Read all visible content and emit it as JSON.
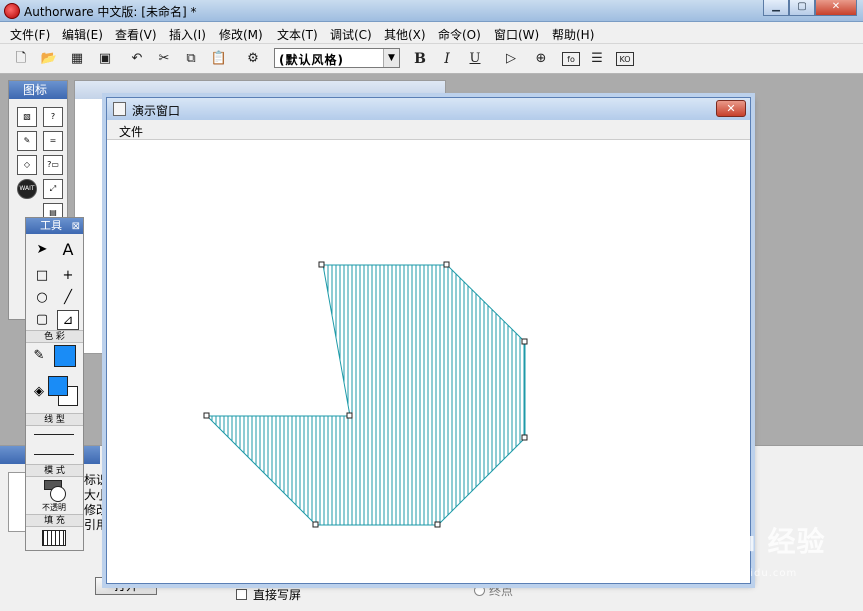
{
  "app": {
    "title": "Authorware 中文版: [未命名] *"
  },
  "menubar": {
    "items": [
      "文件(F)",
      "编辑(E)",
      "查看(V)",
      "插入(I)",
      "修改(M)",
      "文本(T)",
      "调试(C)",
      "其他(X)",
      "命令(O)",
      "窗口(W)",
      "帮助(H)"
    ]
  },
  "toolbar": {
    "style_select_value": "(默认风格)",
    "bold_label": "B",
    "italic_label": "I",
    "underline_label": "U"
  },
  "icons_panel": {
    "title": "图标",
    "wait_icon_label": "WAIT"
  },
  "tools_panel": {
    "title": "工具",
    "color_section": "色 彩",
    "line_section": "线 型",
    "mode_section": "模 式",
    "mode_value": "不透明",
    "fill_section": "填 充",
    "text_tool_label": "A",
    "fill_color": "#1a8cf6"
  },
  "properties": {
    "labels": [
      "标识",
      "大小",
      "修改",
      "引用"
    ],
    "open_button": "打开",
    "direct_write_label": "直接写屏",
    "end_label": "终点"
  },
  "presentation_window": {
    "title": "演示窗口",
    "menu_file": "文件",
    "shape": {
      "fill_pattern": "vertical-lines",
      "stroke_color": "#1e9aa8"
    }
  },
  "watermark": {
    "brand": "Baidu 经验",
    "url": "jingyan.baidu.com"
  }
}
